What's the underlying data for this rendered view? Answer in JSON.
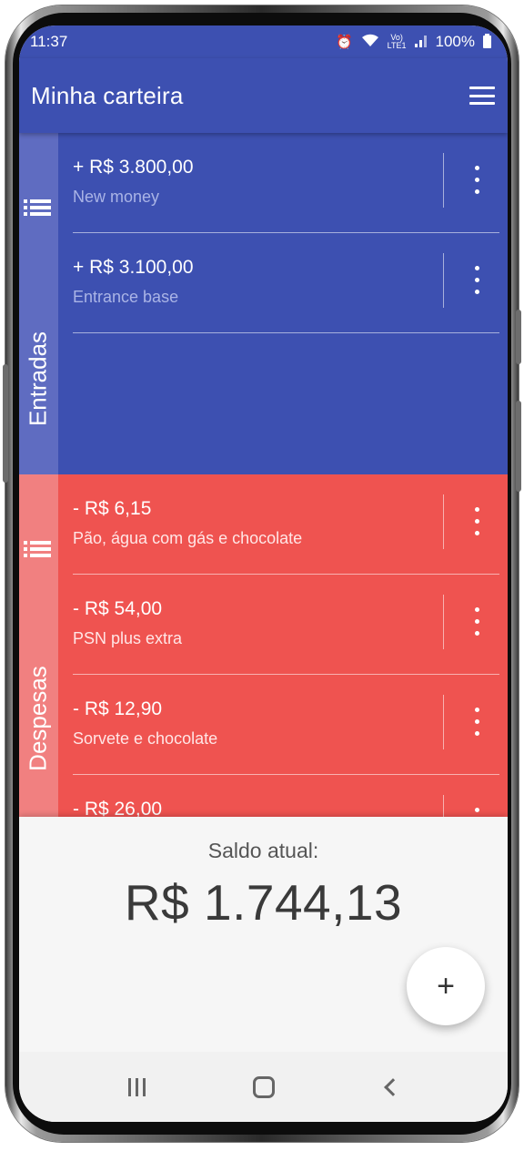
{
  "status_bar": {
    "time": "11:37",
    "battery": "100%",
    "icons": [
      "alarm-icon",
      "wifi-icon",
      "volte-icon",
      "signal-icon",
      "battery-icon"
    ]
  },
  "app_bar": {
    "title": "Minha carteira",
    "menu_icon": "hamburger-menu-icon"
  },
  "incomes": {
    "label": "Entradas",
    "color": "#3d50b1",
    "rail_color": "#5f6cc1",
    "items": [
      {
        "amount": "+ R$ 3.800,00",
        "description": "New money"
      },
      {
        "amount": "+ R$ 3.100,00",
        "description": "Entrance base"
      }
    ]
  },
  "expenses": {
    "label": "Despesas",
    "color": "#ef5350",
    "rail_color": "#f18080",
    "items": [
      {
        "amount": "- R$ 6,15",
        "description": "Pão, água com gás e chocolate"
      },
      {
        "amount": "- R$ 54,00",
        "description": "PSN plus extra"
      },
      {
        "amount": "- R$ 12,90",
        "description": "Sorvete e chocolate"
      },
      {
        "amount": "- R$ 26,00",
        "description": ""
      }
    ]
  },
  "balance": {
    "label": "Saldo atual:",
    "value": "R$ 1.744,13"
  },
  "fab": {
    "label": "+"
  },
  "nav_bar": {
    "icons": [
      "recents-icon",
      "home-icon",
      "back-icon"
    ]
  }
}
